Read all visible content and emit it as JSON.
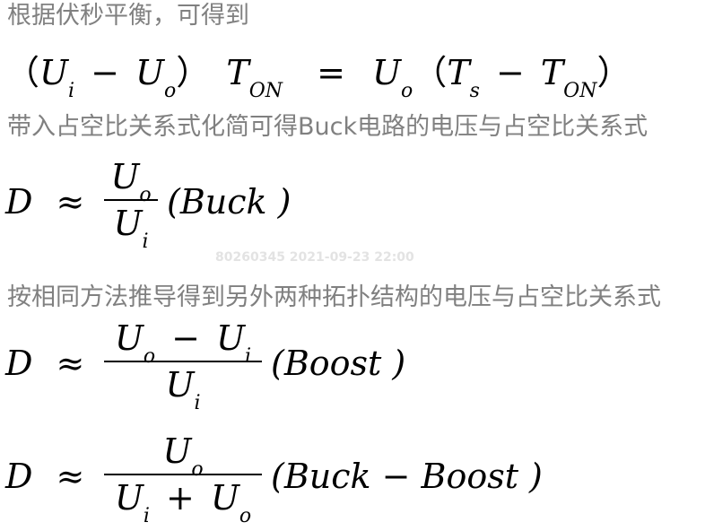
{
  "text": {
    "line1": "根据伏秒平衡，可得到",
    "line2": "带入占空比关系式化简可得Buck电路的电压与占空比关系式",
    "line3": "按相同方法推导得到另外两种拓扑结构的电压与占空比关系式"
  },
  "watermark": "80260345 2021-09-23 22:00",
  "eq1": {
    "lparen": "（",
    "U": "U",
    "i": "i",
    "minus": "−",
    "o": "o",
    "rparen": "）",
    "T": "T",
    "on": "ON",
    "equals": "=",
    "s": "s",
    "lparen2": "（",
    "rparen2": "）"
  },
  "eq2": {
    "D": "D",
    "approx": "≈",
    "num": "U",
    "num_sub": "o",
    "den": "U",
    "den_sub": "i",
    "label": "(Buck )"
  },
  "eq3": {
    "D": "D",
    "approx": "≈",
    "num_a": "U",
    "num_a_sub": "o",
    "num_op": "−",
    "num_b": "U",
    "num_b_sub": "i",
    "den": "U",
    "den_sub": "i",
    "label": "(Boost )"
  },
  "eq4": {
    "D": "D",
    "approx": "≈",
    "num": "U",
    "num_sub": "o",
    "den_a": "U",
    "den_a_sub": "i",
    "den_op": "+",
    "den_b": "U",
    "den_b_sub": "o",
    "label": "(Buck − Boost )"
  }
}
